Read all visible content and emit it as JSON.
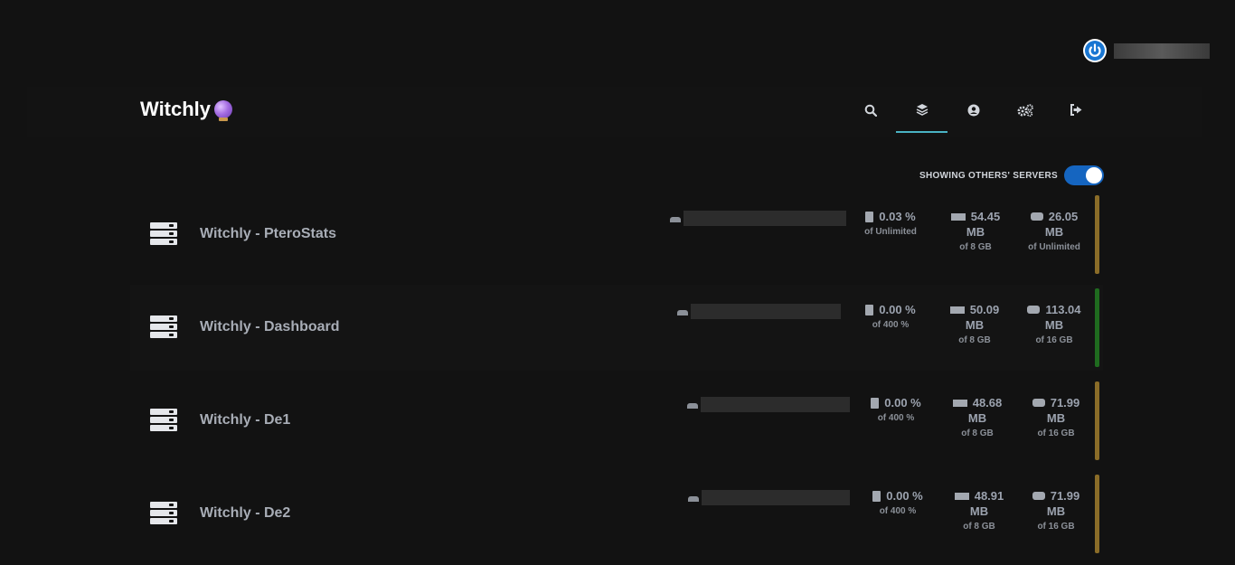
{
  "colors": {
    "toggle_on": "#1565c0",
    "tab_active": "#4ab3c4",
    "status_starting": "#8a6c28",
    "status_running": "#1f6b1f"
  },
  "user": {
    "avatar_icon": "power-icon"
  },
  "brand": {
    "name": "Witchly",
    "emoji_icon": "crystal-ball-icon"
  },
  "nav": {
    "items": [
      {
        "icon": "search-icon",
        "active": false
      },
      {
        "icon": "layers-icon",
        "active": true
      },
      {
        "icon": "user-circle-icon",
        "active": false
      },
      {
        "icon": "cogs-icon",
        "active": false
      },
      {
        "icon": "sign-out-icon",
        "active": false
      }
    ]
  },
  "toggle": {
    "label": "SHOWING OTHERS' SERVERS",
    "on": true
  },
  "servers": [
    {
      "name": "Witchly - PteroStats",
      "cpu": "0.03 %",
      "cpu_limit": "of Unlimited",
      "mem": "54.45",
      "mem_unit": "MB",
      "mem_limit": "of 8 GB",
      "disk": "26.05",
      "disk_unit": "MB",
      "disk_limit": "of Unlimited",
      "status_color": "#8a6c28"
    },
    {
      "name": "Witchly - Dashboard",
      "cpu": "0.00 %",
      "cpu_limit": "of 400 %",
      "mem": "50.09",
      "mem_unit": "MB",
      "mem_limit": "of 8 GB",
      "disk": "113.04",
      "disk_unit": "MB",
      "disk_limit": "of 16 GB",
      "status_color": "#1f6b1f"
    },
    {
      "name": "Witchly - De1",
      "cpu": "0.00 %",
      "cpu_limit": "of 400 %",
      "mem": "48.68",
      "mem_unit": "MB",
      "mem_limit": "of 8 GB",
      "disk": "71.99",
      "disk_unit": "MB",
      "disk_limit": "of 16 GB",
      "status_color": "#8a6c28"
    },
    {
      "name": "Witchly - De2",
      "cpu": "0.00 %",
      "cpu_limit": "of 400 %",
      "mem": "48.91",
      "mem_unit": "MB",
      "mem_limit": "of 8 GB",
      "disk": "71.99",
      "disk_unit": "MB",
      "disk_limit": "of 16 GB",
      "status_color": "#8a6c28"
    }
  ]
}
